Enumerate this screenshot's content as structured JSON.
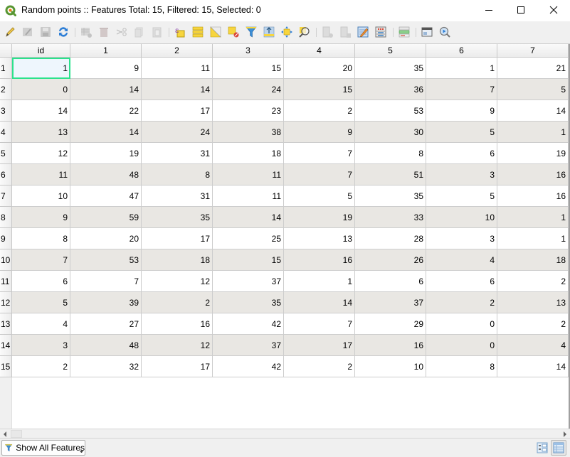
{
  "window": {
    "title": "Random points :: Features Total: 15, Filtered: 15, Selected: 0",
    "app_icon": "qgis-logo-icon",
    "controls": {
      "minimize": "minimize-icon",
      "maximize": "maximize-icon",
      "close": "close-icon"
    }
  },
  "toolbar": {
    "items": [
      {
        "name": "toggle-editing",
        "icon": "pencil-icon",
        "enabled": true
      },
      {
        "name": "toggle-multi-edit",
        "icon": "multi-edit-icon",
        "enabled": false
      },
      {
        "name": "save-edits",
        "icon": "save-icon",
        "enabled": false
      },
      {
        "name": "reload-table",
        "icon": "refresh-icon",
        "enabled": true
      },
      {
        "name": "add-feature",
        "icon": "add-feature-icon",
        "enabled": false
      },
      {
        "name": "delete-selected",
        "icon": "trash-icon",
        "enabled": false
      },
      {
        "name": "cut-selected",
        "icon": "scissors-icon",
        "enabled": false
      },
      {
        "name": "copy-selected",
        "icon": "copy-icon",
        "enabled": false
      },
      {
        "name": "paste-features",
        "icon": "paste-icon",
        "enabled": false
      },
      {
        "name": "select-by-expression",
        "icon": "select-expression-icon",
        "enabled": true
      },
      {
        "name": "select-all",
        "icon": "select-all-icon",
        "enabled": true
      },
      {
        "name": "invert-selection",
        "icon": "invert-selection-icon",
        "enabled": true
      },
      {
        "name": "deselect-all",
        "icon": "deselect-icon",
        "enabled": true
      },
      {
        "name": "filter-select-by-form",
        "icon": "filter-icon",
        "enabled": true
      },
      {
        "name": "move-selection-to-top",
        "icon": "move-to-top-icon",
        "enabled": true
      },
      {
        "name": "pan-map-to-selected",
        "icon": "pan-selection-icon",
        "enabled": true
      },
      {
        "name": "zoom-map-to-selected",
        "icon": "zoom-selection-icon",
        "enabled": true
      },
      {
        "name": "new-field",
        "icon": "new-field-icon",
        "enabled": false
      },
      {
        "name": "delete-field",
        "icon": "delete-field-icon",
        "enabled": false
      },
      {
        "name": "organize-columns",
        "icon": "organize-columns-icon",
        "enabled": true
      },
      {
        "name": "field-calculator",
        "icon": "calculator-icon",
        "enabled": true
      },
      {
        "name": "conditional-formatting",
        "icon": "conditional-format-icon",
        "enabled": true
      },
      {
        "name": "dock-table",
        "icon": "dock-icon",
        "enabled": true
      },
      {
        "name": "actions",
        "icon": "actions-icon",
        "enabled": true
      }
    ]
  },
  "table": {
    "columns": [
      "id",
      "1",
      "2",
      "3",
      "4",
      "5",
      "6",
      "7"
    ],
    "row_headers": [
      "1",
      "2",
      "3",
      "4",
      "5",
      "6",
      "7",
      "8",
      "9",
      "10",
      "11",
      "12",
      "13",
      "14",
      "15"
    ],
    "rows": [
      [
        "1",
        "9",
        "11",
        "15",
        "20",
        "35",
        "1",
        "21"
      ],
      [
        "0",
        "14",
        "14",
        "24",
        "15",
        "36",
        "7",
        "5"
      ],
      [
        "14",
        "22",
        "17",
        "23",
        "2",
        "53",
        "9",
        "14"
      ],
      [
        "13",
        "14",
        "24",
        "38",
        "9",
        "30",
        "5",
        "1"
      ],
      [
        "12",
        "19",
        "31",
        "18",
        "7",
        "8",
        "6",
        "19"
      ],
      [
        "11",
        "48",
        "8",
        "11",
        "7",
        "51",
        "3",
        "16"
      ],
      [
        "10",
        "47",
        "31",
        "11",
        "5",
        "35",
        "5",
        "16"
      ],
      [
        "9",
        "59",
        "35",
        "14",
        "19",
        "33",
        "10",
        "1"
      ],
      [
        "8",
        "20",
        "17",
        "25",
        "13",
        "28",
        "3",
        "1"
      ],
      [
        "7",
        "53",
        "18",
        "15",
        "16",
        "26",
        "4",
        "18"
      ],
      [
        "6",
        "7",
        "12",
        "37",
        "1",
        "6",
        "6",
        "2"
      ],
      [
        "5",
        "39",
        "2",
        "35",
        "14",
        "37",
        "2",
        "13"
      ],
      [
        "4",
        "27",
        "16",
        "42",
        "7",
        "29",
        "0",
        "2"
      ],
      [
        "3",
        "48",
        "12",
        "37",
        "17",
        "16",
        "0",
        "4"
      ],
      [
        "2",
        "32",
        "17",
        "42",
        "2",
        "10",
        "8",
        "14"
      ]
    ],
    "current_cell": {
      "row": 0,
      "col": 0
    },
    "alt_row_color": "#e9e7e3",
    "focus_color": "#2be28c"
  },
  "bottom": {
    "filter_button_label": "Show All Features",
    "filter_icon": "filter-icon",
    "form_view_icon": "form-view-icon",
    "table_view_icon": "table-view-icon"
  }
}
